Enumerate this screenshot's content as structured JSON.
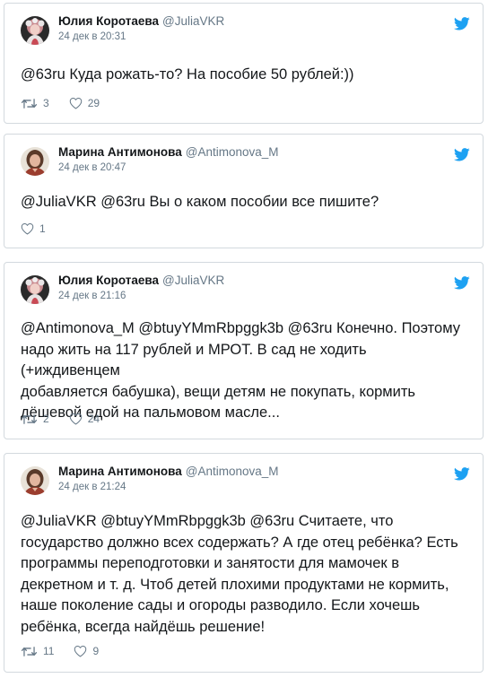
{
  "colors": {
    "text": "#14171a",
    "secondary": "#657786",
    "border": "#d3d9de",
    "twitter_blue": "#1da1f2"
  },
  "tweets": [
    {
      "name": "Юлия Коротаева",
      "handle": "@JuliaVKR",
      "date": "24 дек в 20:31",
      "text": "@63ru Куда рожать-то? На пособие 50 рублей:))",
      "retweets": "3",
      "likes": "29",
      "avatar": "julia-avatar"
    },
    {
      "name": "Марина Антимонова",
      "handle": "@Antimonova_M",
      "date": "24 дек в 20:47",
      "text": "@JuliaVKR @63ru Вы о каком пособии все пишите?",
      "likes": "1",
      "avatar": "marina-avatar"
    },
    {
      "name": "Юлия Коротаева",
      "handle": "@JuliaVKR",
      "date": "24 дек в 21:16",
      "text": "@Antimonova_M @btuyYMmRbpggk3b @63ru Конечно. Поэтому\nнадо жить на 117 рублей и МРОТ. В сад не ходить (+иждивенцем\nдобавляется бабушка), вещи детям не покупать, кормить\nдёшевой едой на пальмовом масле...",
      "retweets": "2",
      "likes": "24",
      "avatar": "julia-avatar"
    },
    {
      "name": "Марина Антимонова",
      "handle": "@Antimonova_M",
      "date": "24 дек в 21:24",
      "text": "@JuliaVKR @btuyYMmRbpggk3b @63ru Считаете, что\nгосударство должно всех содержать? А где отец ребёнка? Есть\nпрограммы переподготовки и занятости для мамочек в\nдекретном и т. д. Чтоб детей плохими продуктами не кормить,\nнаше поколение сады и огороды разводило. Если хочешь\nребёнка, всегда найдёшь решение!",
      "retweets": "11",
      "likes": "9",
      "avatar": "marina-avatar"
    }
  ]
}
